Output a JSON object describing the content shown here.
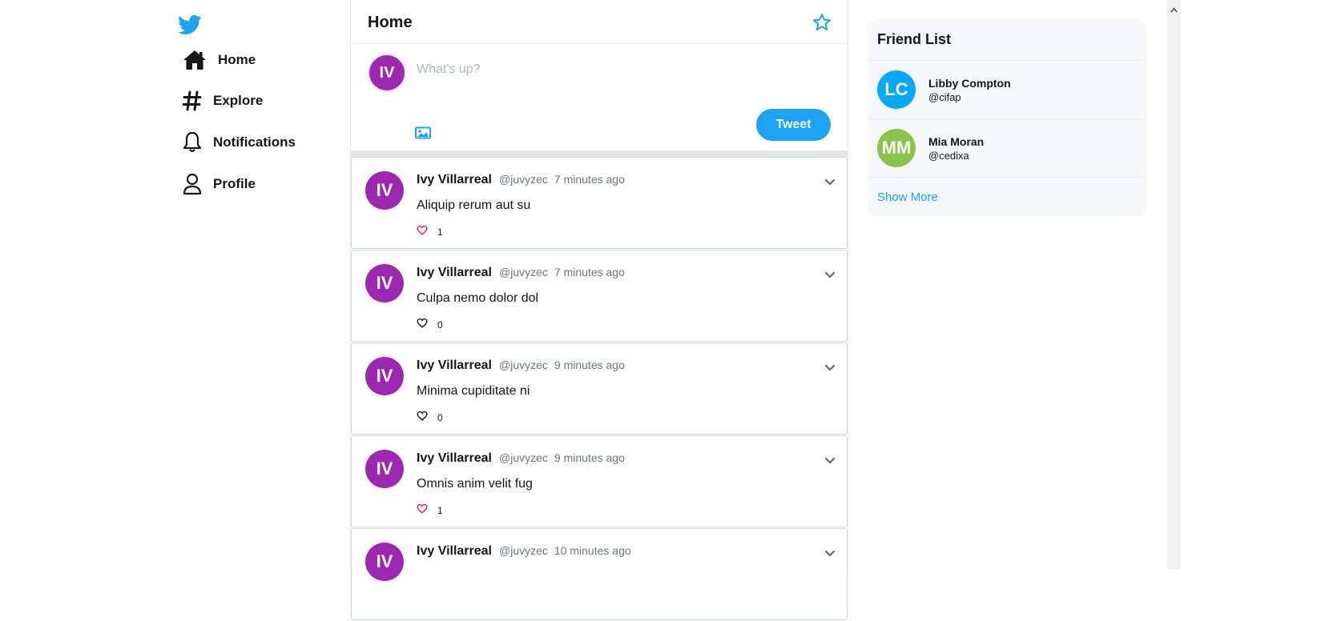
{
  "nav": {
    "items": [
      {
        "label": "Home",
        "icon": "home-icon"
      },
      {
        "label": "Explore",
        "icon": "hash-icon"
      },
      {
        "label": "Notifications",
        "icon": "bell-icon"
      },
      {
        "label": "Profile",
        "icon": "user-icon"
      }
    ]
  },
  "header": {
    "title": "Home"
  },
  "compose": {
    "avatar_initials": "IV",
    "placeholder": "What's up?",
    "tweet_button": "Tweet"
  },
  "tweets": [
    {
      "initials": "IV",
      "name": "Ivy Villarreal",
      "handle": "@juvyzec",
      "time": "7 minutes ago",
      "text": "Aliquip rerum aut su",
      "likes": "1",
      "liked": true
    },
    {
      "initials": "IV",
      "name": "Ivy Villarreal",
      "handle": "@juvyzec",
      "time": "7 minutes ago",
      "text": "Culpa nemo dolor dol",
      "likes": "0",
      "liked": false
    },
    {
      "initials": "IV",
      "name": "Ivy Villarreal",
      "handle": "@juvyzec",
      "time": "9 minutes ago",
      "text": "Minima cupiditate ni",
      "likes": "0",
      "liked": false
    },
    {
      "initials": "IV",
      "name": "Ivy Villarreal",
      "handle": "@juvyzec",
      "time": "9 minutes ago",
      "text": "Omnis anim velit fug",
      "likes": "1",
      "liked": true
    },
    {
      "initials": "IV",
      "name": "Ivy Villarreal",
      "handle": "@juvyzec",
      "time": "10 minutes ago",
      "text": "",
      "likes": "",
      "liked": false
    }
  ],
  "friends": {
    "title": "Friend List",
    "list": [
      {
        "initials": "LC",
        "name": "Libby Compton",
        "handle": "@cifap",
        "color": "#03a9f4"
      },
      {
        "initials": "MM",
        "name": "Mia Moran",
        "handle": "@cedixa",
        "color": "#8bc34a"
      }
    ],
    "show_more": "Show More"
  },
  "colors": {
    "accent": "#1da1f2",
    "avatar_purple": "#9c27b0",
    "like_red": "#e0245e"
  }
}
